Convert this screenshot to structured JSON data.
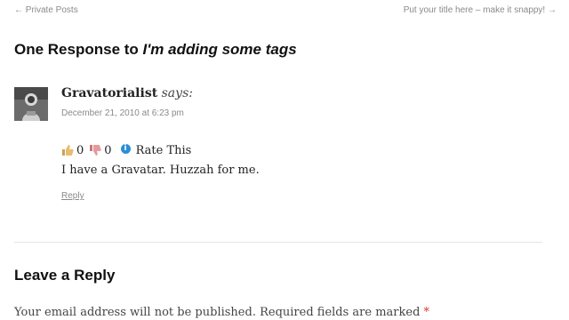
{
  "nav": {
    "previous": "← Private Posts",
    "next": "Put your title here – make it snappy! →"
  },
  "responses": {
    "title_prefix": "One Response to ",
    "post_title": "I'm adding some tags"
  },
  "comment": {
    "author": "Gravatorialist",
    "says": "says:",
    "date": "December 21, 2010 at 6:23 pm",
    "like_count": "0",
    "dislike_count": "0",
    "rate_label": "Rate This",
    "text": "I have a Gravatar. Huzzah for me.",
    "reply_label": "Reply"
  },
  "reply_form": {
    "title": "Leave a Reply",
    "notes": "Your email address will not be published. Required fields are marked",
    "required_marker": "*"
  },
  "icons": {
    "thumbs_up": "thumbs-up-icon",
    "thumbs_down": "thumbs-down-icon",
    "info": "info-icon"
  },
  "colors": {
    "meta_text": "#8a8a8a",
    "required": "#dd3333",
    "info_icon": "#2a8fd6"
  }
}
